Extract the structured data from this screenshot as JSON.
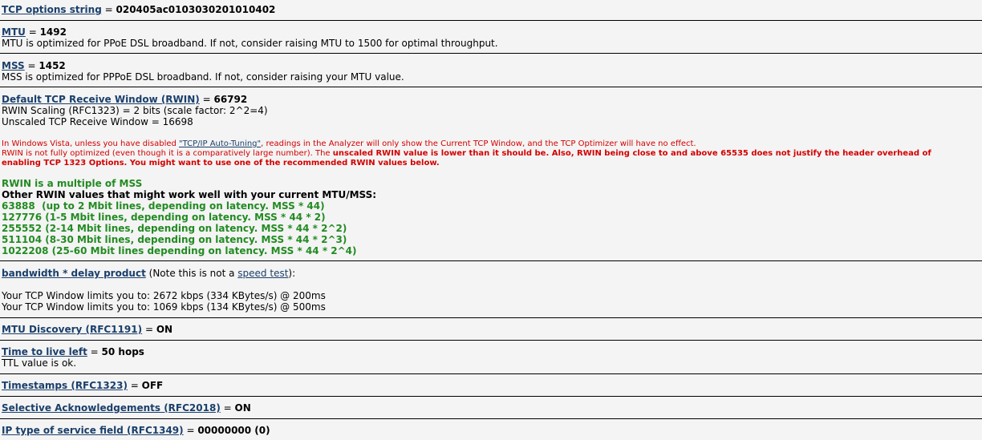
{
  "tcp_options": {
    "label": "TCP options string",
    "eq": " = ",
    "value": "020405ac0103030201010402"
  },
  "mtu": {
    "label": "MTU",
    "eq": " = ",
    "value": "1492",
    "note": "MTU is optimized for PPoE DSL broadband. If not, consider raising MTU to 1500 for optimal throughput."
  },
  "mss": {
    "label": "MSS",
    "eq": " = ",
    "value": "1452",
    "note": "MSS is optimized for PPPoE DSL broadband. If not, consider raising your MTU value."
  },
  "rwin": {
    "label": "Default TCP Receive Window (RWIN)",
    "eq": " = ",
    "value": "66792",
    "scaling": "RWIN Scaling (RFC1323) = 2 bits (scale factor: 2^2=4)",
    "unscaled": "Unscaled TCP Receive Window = 16698",
    "vista_prefix": "In Windows Vista, unless you have disabled ",
    "vista_link": "\"TCP/IP Auto-Tuning\"",
    "vista_suffix": ", readings in the Analyzer will only show the Current TCP Window, and the TCP Optimizer will have no effect.",
    "warn_normal": "RWIN is not fully optimized (even though it is a comparatively large number). The ",
    "warn_bold_1": "unscaled RWIN value is lower than it should be. Also, RWIN being close to and above 65535 does not justify the header overhead of",
    "warn_bold_2": "enabling TCP 1323 Options. You might want to use one of the recommended RWIN values below.",
    "multiple": "RWIN is a multiple of MSS",
    "other_heading": "Other RWIN values that might work well with your current MTU/MSS:",
    "recommended": [
      "63888  (up to 2 Mbit lines, depending on latency. MSS * 44)",
      "127776 (1-5 Mbit lines, depending on latency. MSS * 44 * 2)",
      "255552 (2-14 Mbit lines, depending on latency. MSS * 44 * 2^2)",
      "511104 (8-30 Mbit lines, depending on latency. MSS * 44 * 2^3)",
      "1022208 (25-60 Mbit lines depending on latency. MSS * 44 * 2^4)"
    ]
  },
  "bdp": {
    "label": "bandwidth * delay product",
    "note_prefix": " (Note this is not a ",
    "note_link": "speed test",
    "note_suffix": "):",
    "line1": "Your TCP Window limits you to: 2672 kbps (334 KBytes/s) @ 200ms",
    "line2": "Your TCP Window limits you to: 1069 kbps (134 KBytes/s) @ 500ms"
  },
  "mtu_discovery": {
    "label": "MTU Discovery (RFC1191)",
    "eq": " = ",
    "value": "ON"
  },
  "ttl": {
    "label": "Time to live left",
    "eq": " = ",
    "value": "50 hops",
    "note": "TTL value is ok."
  },
  "timestamps": {
    "label": "Timestamps (RFC1323)",
    "eq": " = ",
    "value": "OFF"
  },
  "sack": {
    "label": "Selective Acknowledgements (RFC2018)",
    "eq": " = ",
    "value": "ON"
  },
  "tos": {
    "label": "IP type of service field (RFC1349)",
    "eq": " = ",
    "value": "00000000 (0)"
  }
}
